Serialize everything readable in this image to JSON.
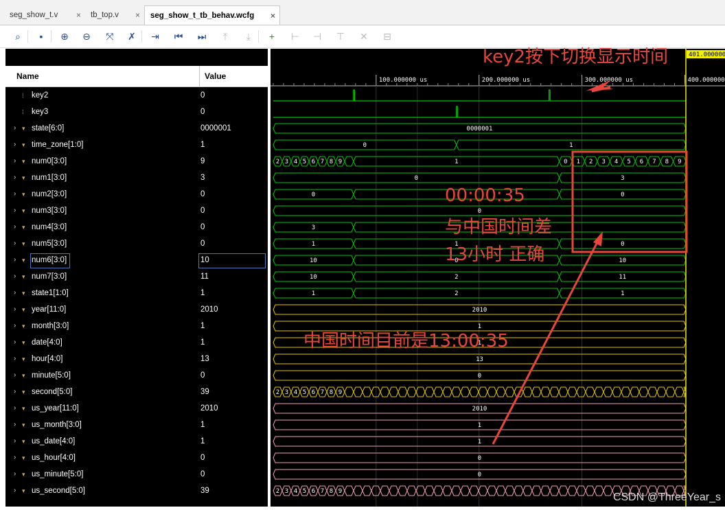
{
  "tabs": [
    {
      "label": "seg_show_t.v"
    },
    {
      "label": "tb_top.v"
    },
    {
      "label": "seg_show_t_tb_behav.wcfg"
    }
  ],
  "columns": {
    "name": "Name",
    "value": "Value"
  },
  "toolbar_icons": [
    "search-icon",
    "save-icon",
    "zoom-in-icon",
    "zoom-out-icon",
    "zoom-fit-icon",
    "cursor-icon",
    "goto-cursor-icon",
    "goto-start-icon",
    "goto-end-icon",
    "prev-transition-icon",
    "next-transition-icon",
    "add-marker-icon",
    "prev-marker-icon",
    "next-marker-icon",
    "delete-marker-icon",
    "swap-cursors-icon",
    "expand-icon"
  ],
  "signals": [
    {
      "name": "key2",
      "value": "0",
      "type": "bit"
    },
    {
      "name": "key3",
      "value": "0",
      "type": "bit"
    },
    {
      "name": "state[6:0]",
      "value": "0000001",
      "type": "bus"
    },
    {
      "name": "time_zone[1:0]",
      "value": "1",
      "type": "bus"
    },
    {
      "name": "num0[3:0]",
      "value": "9",
      "type": "bus"
    },
    {
      "name": "num1[3:0]",
      "value": "3",
      "type": "bus"
    },
    {
      "name": "num2[3:0]",
      "value": "0",
      "type": "bus"
    },
    {
      "name": "num3[3:0]",
      "value": "0",
      "type": "bus"
    },
    {
      "name": "num4[3:0]",
      "value": "0",
      "type": "bus"
    },
    {
      "name": "num5[3:0]",
      "value": "0",
      "type": "bus"
    },
    {
      "name": "num6[3:0]",
      "value": "10",
      "type": "bus"
    },
    {
      "name": "num7[3:0]",
      "value": "11",
      "type": "bus"
    },
    {
      "name": "state1[1:0]",
      "value": "1",
      "type": "bus"
    },
    {
      "name": "year[11:0]",
      "value": "2010",
      "type": "bus"
    },
    {
      "name": "month[3:0]",
      "value": "1",
      "type": "bus"
    },
    {
      "name": "date[4:0]",
      "value": "1",
      "type": "bus"
    },
    {
      "name": "hour[4:0]",
      "value": "13",
      "type": "bus"
    },
    {
      "name": "minute[5:0]",
      "value": "0",
      "type": "bus"
    },
    {
      "name": "second[5:0]",
      "value": "39",
      "type": "bus"
    },
    {
      "name": "us_year[11:0]",
      "value": "2010",
      "type": "bus"
    },
    {
      "name": "us_month[3:0]",
      "value": "1",
      "type": "bus"
    },
    {
      "name": "us_date[4:0]",
      "value": "1",
      "type": "bus"
    },
    {
      "name": "us_hour[4:0]",
      "value": "0",
      "type": "bus"
    },
    {
      "name": "us_minute[5:0]",
      "value": "0",
      "type": "bus"
    },
    {
      "name": "us_second[5:0]",
      "value": "39",
      "type": "bus"
    }
  ],
  "time_axis": {
    "ticks": [
      "100.000000 us",
      "200.000000 us",
      "300.000000 us",
      "400.000000 us"
    ],
    "cursor_label": "401.000000"
  },
  "wave_labels": {
    "state": "0000001",
    "time_zone": [
      "0",
      "1"
    ],
    "num0_counting": [
      "2",
      "3",
      "4",
      "5",
      "6",
      "7",
      "8",
      "9"
    ],
    "num0_mid": "1",
    "num0_end": [
      "0",
      "1",
      "2",
      "3",
      "4",
      "5",
      "6",
      "7",
      "8",
      "9"
    ],
    "num1_mid": "0",
    "num1_end": "3",
    "num2_a": "0",
    "num2_end": "0",
    "num3": "0",
    "num4_a": "3",
    "num5_a": "1",
    "num5_b": "1",
    "num5_end": "0",
    "num6_a": "10",
    "num6_b": "0",
    "num6_end": "10",
    "num7_a": "10",
    "num7_b": "2",
    "num7_end": "11",
    "state1_a": "1",
    "state1_b": "2",
    "state1_end": "1",
    "year": "2010",
    "month": "1",
    "date": "1",
    "hour": "13",
    "minute": "0",
    "second_counting": [
      "2",
      "3",
      "4",
      "5",
      "6",
      "7",
      "8",
      "9"
    ],
    "us_year": "2010",
    "us_month": "1",
    "us_date": "1",
    "us_hour": "0",
    "us_minute": "0",
    "us_second_counting": [
      "2",
      "3",
      "4",
      "5",
      "6",
      "7",
      "8",
      "9"
    ]
  },
  "annotations": {
    "key2_note": "key2按下切换显示时间",
    "us_time": "00:00:35",
    "diff_line1": "与中国时间差",
    "diff_line2": "13小时 正确",
    "china_time": "中国时间目前是13:00:35"
  },
  "watermark": "CSDN @ThreeYear_s",
  "colors": {
    "green": "#00c800",
    "yellow": "#e6c800",
    "pink": "#f4a0b0",
    "cursor": "#f0f000",
    "annotation_red": "#e8453c"
  }
}
